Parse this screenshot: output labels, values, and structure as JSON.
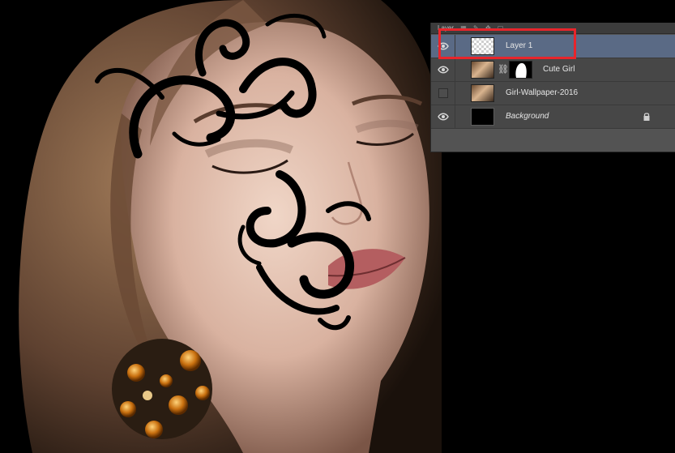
{
  "panel": {
    "tab_label": "Layer",
    "layers": [
      {
        "name": "Layer 1",
        "thumbnail": "transparent-checker",
        "visible": true,
        "selected": true
      },
      {
        "name": "Cute Girl",
        "thumbnail": "photo-with-mask",
        "visible": true,
        "selected": false
      },
      {
        "name": "Girl-Wallpaper-2016",
        "thumbnail": "photo",
        "visible": false,
        "selected": false
      },
      {
        "name": "Background",
        "thumbnail": "black",
        "visible": true,
        "selected": false,
        "locked": true
      }
    ]
  },
  "icons": {
    "visibility": "eye-icon",
    "link": "chain-link-icon",
    "lock": "lock-icon"
  },
  "colors": {
    "highlight": "#e8252b",
    "selected_row": "#5a6a85",
    "panel_bg": "#535353"
  }
}
